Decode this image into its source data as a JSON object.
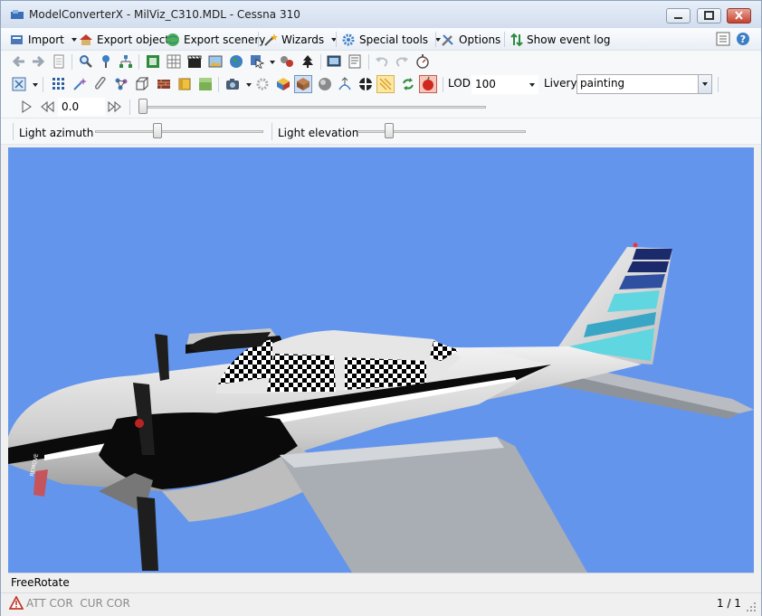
{
  "window": {
    "title": "ModelConverterX - MilViz_C310.MDL - Cessna 310"
  },
  "menu": {
    "import": "Import",
    "export_object": "Export object",
    "export_scenery": "Export scenery",
    "wizards": "Wizards",
    "special_tools": "Special tools",
    "options": "Options",
    "show_event_log": "Show event log"
  },
  "toolbar3": {
    "lod_label": "LOD",
    "lod_value": "100",
    "livery_label": "Livery",
    "livery_value": "painting"
  },
  "animation": {
    "time_value": "0.0"
  },
  "lighting": {
    "azimuth_label": "Light azimuth",
    "elevation_label": "Light elevation",
    "azimuth_level": 0.37,
    "elevation_level": 0.19
  },
  "status": {
    "mode": "FreeRotate",
    "warnings": "ATT COR  CUR COR",
    "page": "1 / 1"
  },
  "colors": {
    "viewport_bg": "#6495ed",
    "accent": "#3c7fc4"
  }
}
